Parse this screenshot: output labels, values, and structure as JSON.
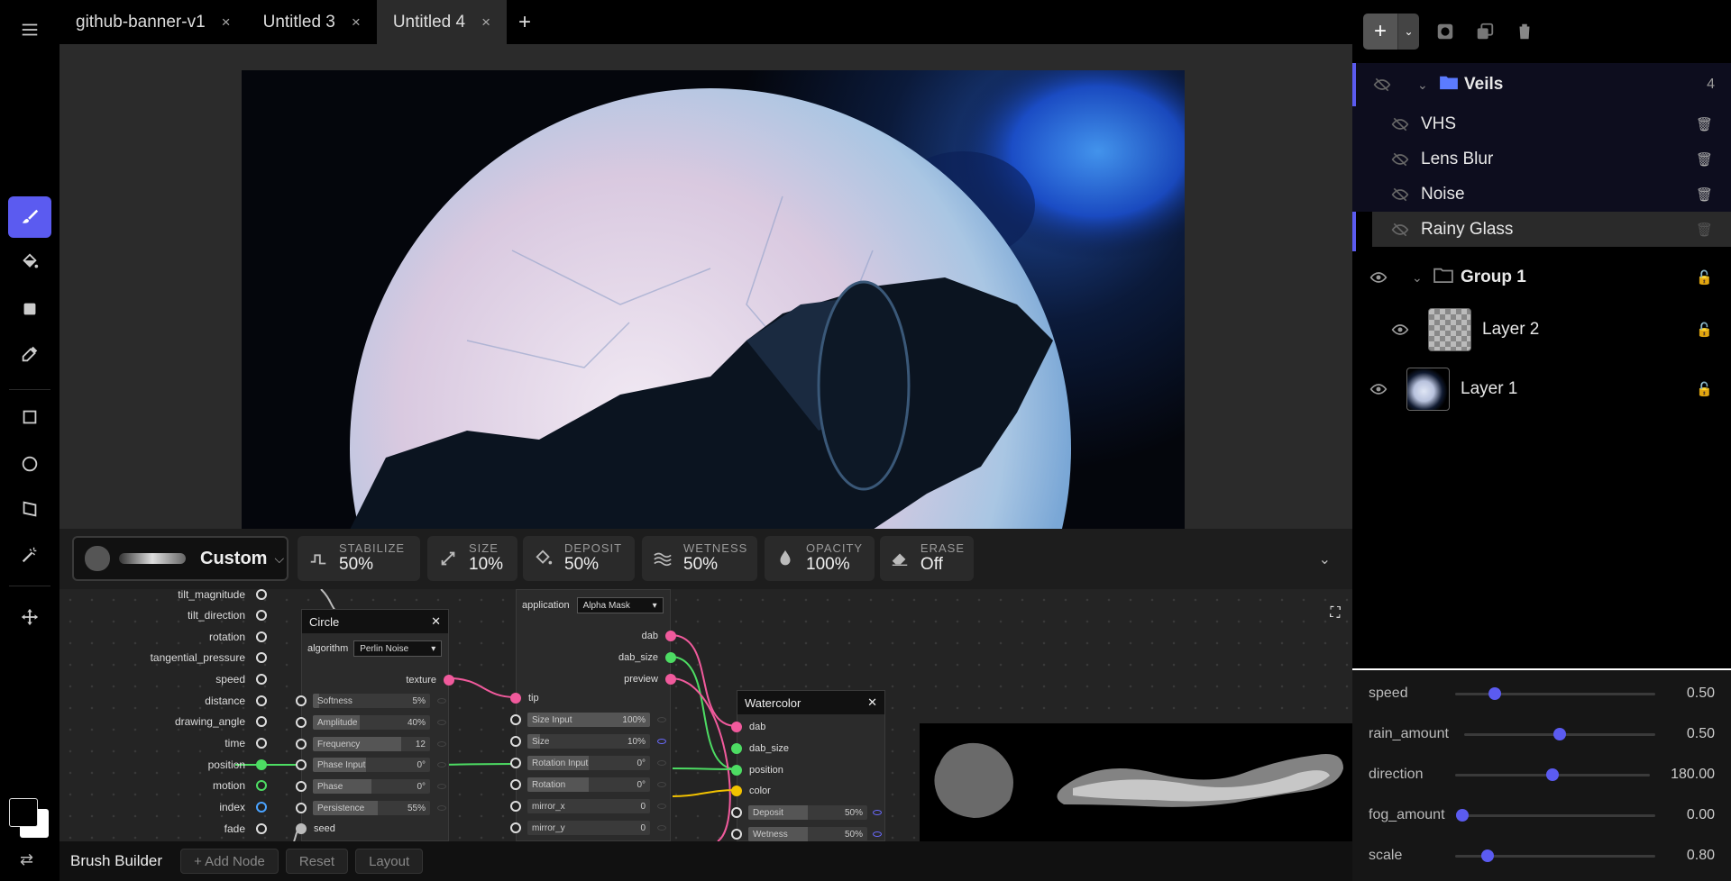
{
  "tabs": [
    {
      "label": "github-banner-v1",
      "active": false
    },
    {
      "label": "Untitled 3",
      "active": false
    },
    {
      "label": "Untitled 4",
      "active": true
    }
  ],
  "tab_close_glyph": "×",
  "tab_add_glyph": "+",
  "toolbar": {
    "tools": [
      "brush-icon",
      "fill-bucket-icon",
      "square-fill-icon",
      "eyedropper-icon",
      "rectangle-icon",
      "ellipse-icon",
      "crop-icon",
      "magic-wand-icon",
      "move-icon"
    ],
    "active_tool": "brush-icon",
    "accent": "#5b5bf0"
  },
  "brush": {
    "preset_name": "Custom",
    "params": [
      {
        "label": "STABILIZE",
        "value": "50%",
        "icon": "stabilize-icon"
      },
      {
        "label": "SIZE",
        "value": "10%",
        "icon": "resize-icon"
      },
      {
        "label": "DEPOSIT",
        "value": "50%",
        "icon": "bucket-icon"
      },
      {
        "label": "WETNESS",
        "value": "50%",
        "icon": "waves-icon"
      },
      {
        "label": "OPACITY",
        "value": "100%",
        "icon": "droplet-icon"
      },
      {
        "label": "ERASE",
        "value": "Off",
        "icon": "eraser-icon"
      }
    ]
  },
  "node_editor": {
    "inputs": [
      "tilt_magnitude",
      "tilt_direction",
      "rotation",
      "tangential_pressure",
      "speed",
      "distance",
      "drawing_angle",
      "time",
      "position",
      "motion",
      "index",
      "fade"
    ],
    "circle_node": {
      "title": "Circle",
      "algorithm_label": "algorithm",
      "algorithm_value": "Perlin Noise",
      "output_label": "texture",
      "fields": [
        {
          "label": "Softness",
          "value": "5%",
          "fill": 0.05
        },
        {
          "label": "Amplitude",
          "value": "40%",
          "fill": 0.4
        },
        {
          "label": "Frequency",
          "value": "12",
          "fill": 0.75
        },
        {
          "label": "Phase Input",
          "value": "0°",
          "fill": 0.45
        },
        {
          "label": "Phase",
          "value": "0°",
          "fill": 0.5
        },
        {
          "label": "Persistence",
          "value": "55%",
          "fill": 0.55
        }
      ],
      "seed_label": "seed"
    },
    "application_node": {
      "application_label": "application",
      "application_value": "Alpha Mask",
      "outputs": [
        "dab",
        "dab_size",
        "preview"
      ],
      "tip_label": "tip",
      "fields": [
        {
          "label": "Size Input",
          "value": "100%",
          "fill": 1.0
        },
        {
          "label": "Size",
          "value": "10%",
          "fill": 0.1
        },
        {
          "label": "Rotation Input",
          "value": "0°",
          "fill": 0.5
        },
        {
          "label": "Rotation",
          "value": "0°",
          "fill": 0.5
        },
        {
          "label": "mirror_x",
          "value": "0",
          "fill": 0.0
        },
        {
          "label": "mirror_y",
          "value": "0",
          "fill": 0.0
        }
      ]
    },
    "watercolor_node": {
      "title": "Watercolor",
      "inputs": [
        "dab",
        "dab_size",
        "position",
        "color"
      ],
      "fields": [
        {
          "label": "Deposit",
          "value": "50%",
          "fill": 0.5
        },
        {
          "label": "Wetness",
          "value": "50%",
          "fill": 0.5
        }
      ]
    }
  },
  "bottom_bar": {
    "title": "Brush Builder",
    "buttons": [
      "+ Add Node",
      "Reset",
      "Layout"
    ]
  },
  "layers_panel": {
    "groups": [
      {
        "name": "Veils",
        "count": "4",
        "visible": false,
        "children": [
          "VHS",
          "Lens Blur",
          "Noise",
          "Rainy Glass"
        ],
        "selected_child": "Rainy Glass"
      },
      {
        "name": "Group 1",
        "visible": true,
        "children": [
          "Layer 2"
        ]
      }
    ],
    "top_layer": "Layer 1"
  },
  "properties": [
    {
      "name": "speed",
      "value": "0.50",
      "fraction": 0.2
    },
    {
      "name": "rain_amount",
      "value": "0.50",
      "fraction": 0.5
    },
    {
      "name": "direction",
      "value": "180.00",
      "fraction": 0.5
    },
    {
      "name": "fog_amount",
      "value": "0.00",
      "fraction": 0.0
    },
    {
      "name": "scale",
      "value": "0.80",
      "fraction": 0.16
    }
  ]
}
